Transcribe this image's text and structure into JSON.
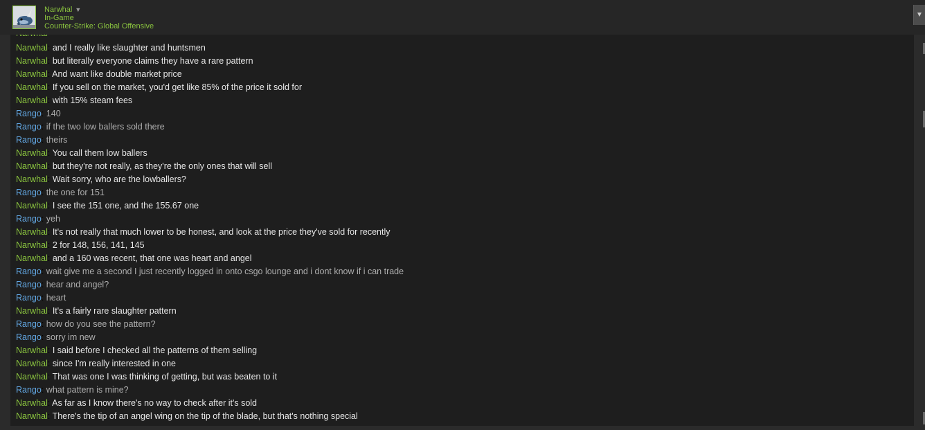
{
  "user": {
    "name": "Narwhal",
    "status": "In-Game",
    "game": "Counter-Strike: Global Offensive",
    "dropdown_glyph": "▼"
  },
  "colors": {
    "narwhal": "#8bc53f",
    "rango": "#62a7e3",
    "narwhal_text": "#e6e6e6",
    "rango_text": "#aeaeae"
  },
  "header_button_glyph": "▼",
  "messages": [
    {
      "sender": "Narwhal",
      "text": "and I really like slaughter and huntsmen"
    },
    {
      "sender": "Narwhal",
      "text": "but literally everyone claims they have a rare pattern"
    },
    {
      "sender": "Narwhal",
      "text": "And want like double market price"
    },
    {
      "sender": "Narwhal",
      "text": "If you sell on the market, you'd get like 85% of the price it sold for"
    },
    {
      "sender": "Narwhal",
      "text": "with 15% steam fees"
    },
    {
      "sender": "Rango",
      "text": "140"
    },
    {
      "sender": "Rango",
      "text": "if the two low ballers sold there"
    },
    {
      "sender": "Rango",
      "text": "theirs"
    },
    {
      "sender": "Narwhal",
      "text": "You call them low ballers"
    },
    {
      "sender": "Narwhal",
      "text": "but they're not really, as they're the only ones that will sell"
    },
    {
      "sender": "Narwhal",
      "text": "Wait sorry, who are the lowballers?"
    },
    {
      "sender": "Rango",
      "text": "the one for 151"
    },
    {
      "sender": "Narwhal",
      "text": "I see the 151 one, and the 155.67 one"
    },
    {
      "sender": "Rango",
      "text": "yeh"
    },
    {
      "sender": "Narwhal",
      "text": "It's not really that much lower to be honest, and look at the price they've sold for recently"
    },
    {
      "sender": "Narwhal",
      "text": "2 for 148, 156, 141, 145"
    },
    {
      "sender": "Narwhal",
      "text": "and a 160 was recent, that one was heart and angel"
    },
    {
      "sender": "Rango",
      "text": "wait give me a second I just recently logged in onto csgo lounge and i dont know if i can trade"
    },
    {
      "sender": "Rango",
      "text": "hear and angel?"
    },
    {
      "sender": "Rango",
      "text": "heart"
    },
    {
      "sender": "Narwhal",
      "text": "It's a fairly rare slaughter pattern"
    },
    {
      "sender": "Rango",
      "text": "how do you see the pattern?"
    },
    {
      "sender": "Rango",
      "text": "sorry im new"
    },
    {
      "sender": "Narwhal",
      "text": "I said before I checked all the patterns of them selling"
    },
    {
      "sender": "Narwhal",
      "text": "since I'm really interested in one"
    },
    {
      "sender": "Narwhal",
      "text": "That was one I was thinking of getting, but was beaten to it"
    },
    {
      "sender": "Rango",
      "text": "what pattern is mine?"
    },
    {
      "sender": "Narwhal",
      "text": "As far as I know there's no way to check after it's sold"
    },
    {
      "sender": "Narwhal",
      "text": "There's the tip of an angel wing on the tip of the blade, but that's nothing special"
    }
  ]
}
